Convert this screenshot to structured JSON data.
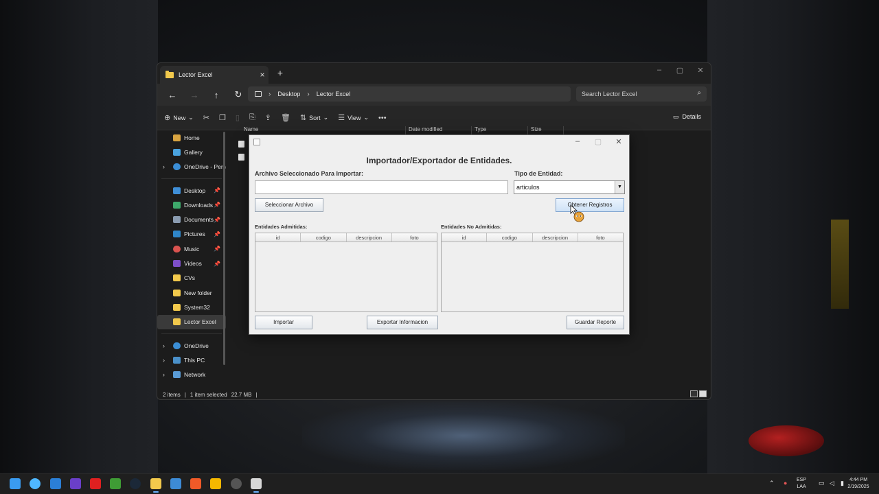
{
  "explorer": {
    "tab_title": "Lector Excel",
    "tab_new": "+",
    "nav": {
      "back": "←",
      "forward": "→",
      "up": "↑",
      "refresh": "↻"
    },
    "breadcrumb": [
      "Desktop",
      "Lector Excel"
    ],
    "search_placeholder": "Search Lector Excel",
    "toolbar": {
      "new_label": "New",
      "sort_label": "Sort",
      "view_label": "View",
      "details_label": "Details"
    },
    "columns": [
      "Name",
      "Date modified",
      "Type",
      "Size"
    ],
    "sidebar": {
      "top": [
        "Home",
        "Gallery",
        "OneDrive - Pers"
      ],
      "quick": [
        "Desktop",
        "Downloads",
        "Documents",
        "Pictures",
        "Music",
        "Videos",
        "CVs",
        "New folder",
        "System32",
        "Lector Excel"
      ],
      "bottom": [
        "OneDrive",
        "This PC",
        "Network"
      ]
    },
    "status": {
      "items": "2 items",
      "selected": "1 item selected",
      "size": "22.7 MB"
    }
  },
  "dialog": {
    "heading": "Importador/Exportador de Entidades.",
    "file_label": "Archivo Seleccionado Para Importar:",
    "file_value": "",
    "type_label": "Tipo de Entidad:",
    "type_value": "articulos",
    "select_file_button": "Seleccionar Archivo",
    "get_records_button": "Obtener Registros",
    "admitted_label": "Entidades Admitidas:",
    "not_admitted_label": "Entidades No Admitidas:",
    "table_columns": [
      "id",
      "codigo",
      "descripcion",
      "foto"
    ],
    "import_button": "Importar",
    "export_button": "Exportar Informacion",
    "save_report_button": "Guardar Reporte"
  },
  "taskbar": {
    "lang": "ESP",
    "lang_sub": "LAA",
    "time": "4:44 PM",
    "date": "2/19/2025"
  }
}
